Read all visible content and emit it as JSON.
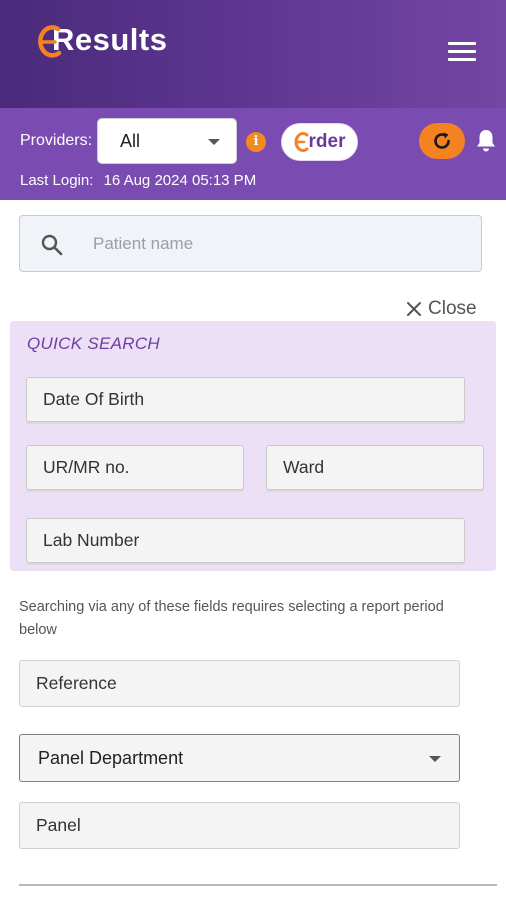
{
  "header": {
    "logo_text": "Results",
    "menu_icon": "hamburger-menu-icon"
  },
  "toolbar": {
    "providers_label": "Providers:",
    "providers_value": "All",
    "order_label": "rder",
    "last_login_label": "Last Login:",
    "last_login_value": "16 Aug 2024 05:13 PM"
  },
  "search": {
    "placeholder": "Patient name"
  },
  "close_label": "Close",
  "quick_search": {
    "title": "QUICK SEARCH",
    "dob_placeholder": "Date Of Birth",
    "ur_placeholder": "UR/MR no.",
    "ward_placeholder": "Ward",
    "lab_placeholder": "Lab Number"
  },
  "helper_text": "Searching via any of these fields requires selecting a report period below",
  "filters": {
    "reference_placeholder": "Reference",
    "panel_department": "Panel Department",
    "panel_placeholder": "Panel"
  },
  "colors": {
    "header_dark": "#4a2a7a",
    "header_light": "#7446a4",
    "toolbar_bg": "#7a4bb0",
    "accent_orange": "#f58220",
    "quick_bg": "#ebe0f5",
    "quick_title": "#6e3fa0"
  }
}
